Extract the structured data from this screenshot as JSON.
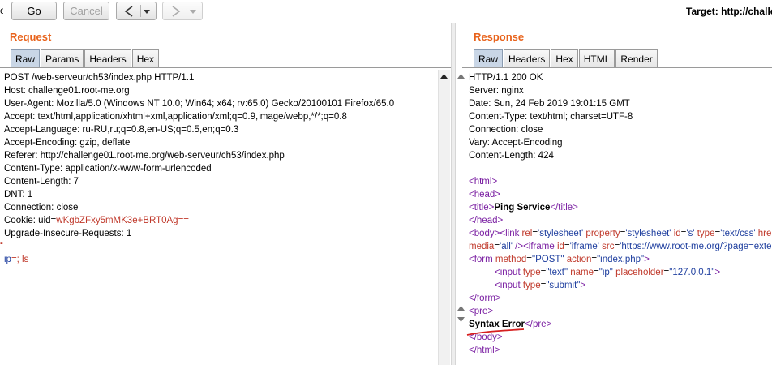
{
  "toolbar": {
    "edge_glyph": "e",
    "go_label": "Go",
    "cancel_label": "Cancel",
    "back_icon": "back-chevron",
    "forward_icon": "forward-chevron",
    "target_label": "Target: http://challe"
  },
  "request": {
    "title": "Request",
    "tabs": [
      "Raw",
      "Params",
      "Headers",
      "Hex"
    ],
    "active_tab": "Raw",
    "lines": {
      "l0": "POST /web-serveur/ch53/index.php HTTP/1.1",
      "l1": "Host: challenge01.root-me.org",
      "l2": "User-Agent: Mozilla/5.0 (Windows NT 10.0; Win64; x64; rv:65.0) Gecko/20100101 Firefox/65.0",
      "l3": "Accept: text/html,application/xhtml+xml,application/xml;q=0.9,image/webp,*/*;q=0.8",
      "l4": "Accept-Language: ru-RU,ru;q=0.8,en-US;q=0.5,en;q=0.3",
      "l5": "Accept-Encoding: gzip, deflate",
      "l6": "Referer: http://challenge01.root-me.org/web-serveur/ch53/index.php",
      "l7": "Content-Type: application/x-www-form-urlencoded",
      "l8": "Content-Length: 7",
      "l9": "DNT: 1",
      "l10": "Connection: close",
      "cookie_name": "Cookie: uid",
      "cookie_eq": "=",
      "cookie_value": "wKgbZFxy5mMK3e+BRT0Ag==",
      "l12": "Upgrade-Insecure-Requests: 1",
      "body_param": "ip",
      "body_eq": "=; ls"
    }
  },
  "response": {
    "title": "Response",
    "tabs": [
      "Raw",
      "Headers",
      "Hex",
      "HTML",
      "Render"
    ],
    "active_tab": "Raw",
    "headers": [
      "HTTP/1.1 200 OK",
      "Server: nginx",
      "Date: Sun, 24 Feb 2019 19:01:15 GMT",
      "Content-Type: text/html; charset=UTF-8",
      "Connection: close",
      "Vary: Accept-Encoding",
      "Content-Length: 424"
    ],
    "html": {
      "html_open": "<html>",
      "head_open": "<head>",
      "title_open": "<title>",
      "title_text": "Ping Service",
      "title_close": "</title>",
      "head_close": "</head>",
      "body_open": "<body>",
      "link_open": "<link ",
      "link_rel_attr": "rel",
      "link_rel_val": "'stylesheet'",
      "link_prop_attr": "property",
      "link_prop_val": "'stylesheet'",
      "link_id_attr": "id",
      "link_id_val": "'s'",
      "link_type_attr": "type",
      "link_type_val": "'text/css'",
      "link_href_attr": "hre",
      "media_attr": "media",
      "media_val": "'all'",
      "link_close": " />",
      "iframe_open": "<iframe ",
      "iframe_id_attr": "id",
      "iframe_id_val": "'iframe'",
      "iframe_src_attr": "src",
      "iframe_src_val": "'https://www.root-me.org/?page=exter",
      "form_open": "<form ",
      "form_method_attr": "method",
      "form_method_val": "\"POST\"",
      "form_action_attr": "action",
      "form_action_val": "\"index.php\"",
      "form_end": ">",
      "input1_open": "<input ",
      "input1_type_attr": "type",
      "input1_type_val": "\"text\"",
      "input1_name_attr": "name",
      "input1_name_val": "\"ip\"",
      "input1_ph_attr": "placeholder",
      "input1_ph_val": "\"127.0.0.1\"",
      "input1_close": ">",
      "input2_open": "<input ",
      "input2_type_attr": "type",
      "input2_type_val": "\"submit\"",
      "input2_close": ">",
      "form_close": "</form>",
      "pre_open": "<pre>",
      "syntax_error": "Syntax Error",
      "pre_close": "</pre>",
      "body_close": "</body>",
      "html_close": "</html>"
    }
  },
  "colors": {
    "section_title": "#e8631c",
    "active_tab": "#c9d6e6",
    "tag": "#7a1fa2",
    "attr": "#c0392b",
    "value": "#1f3f9f",
    "underline": "#d62020"
  }
}
